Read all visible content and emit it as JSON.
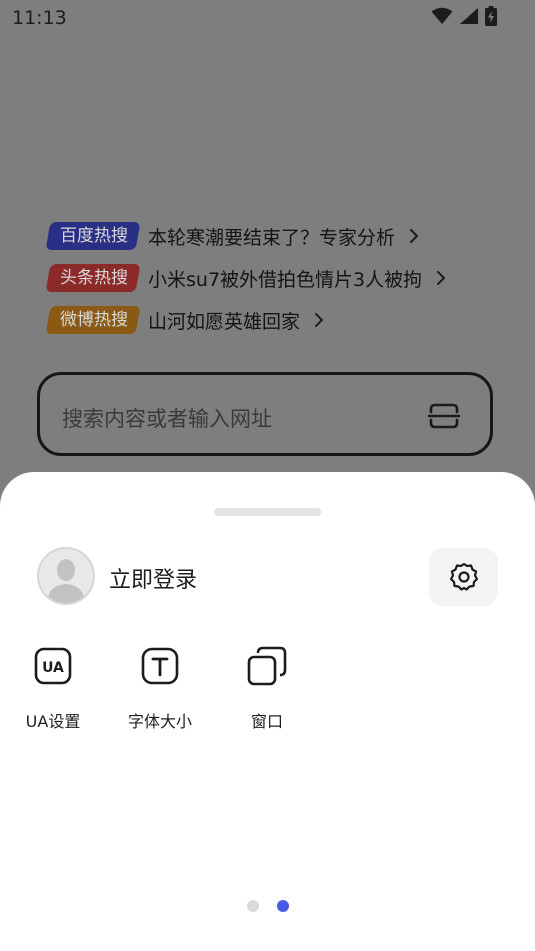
{
  "status_bar": {
    "time": "11:13",
    "icons": [
      "wifi-icon",
      "signal-icon",
      "battery-charging-icon"
    ]
  },
  "hot_list": [
    {
      "tag": "百度热搜",
      "text": "本轮寒潮要结束了？专家分析",
      "tag_color": "#2a2f86"
    },
    {
      "tag": "头条热搜",
      "text": "小米su7被外借拍色情片3人被拘",
      "tag_color": "#8c2a2a"
    },
    {
      "tag": "微博热搜",
      "text": "山河如愿英雄回家",
      "tag_color": "#8a5a14"
    }
  ],
  "search": {
    "placeholder": "搜索内容或者输入网址",
    "scan_icon": "scan-icon"
  },
  "sheet": {
    "login_label": "立即登录",
    "settings_icon": "gear-icon",
    "tools": [
      {
        "label": "UA设置",
        "icon": "ua-icon"
      },
      {
        "label": "字体大小",
        "icon": "font-size-icon"
      },
      {
        "label": "窗口",
        "icon": "window-icon"
      }
    ],
    "page_indicator": {
      "total": 2,
      "active": 2,
      "active_color": "#4a5ae8",
      "inactive_color": "#d9d9d9"
    }
  }
}
